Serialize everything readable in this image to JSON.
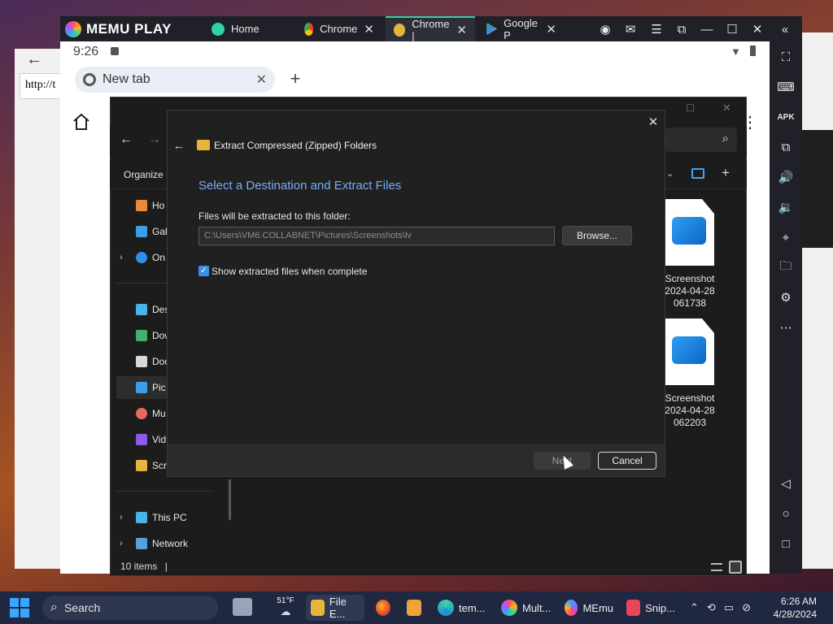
{
  "memu": {
    "logo_text": "MEMU PLAY",
    "tabs": [
      {
        "label": "Home"
      },
      {
        "label": "Chrome"
      },
      {
        "label": "Chrome |"
      },
      {
        "label": "Google P"
      }
    ]
  },
  "background_browser": {
    "address": "http://t"
  },
  "android": {
    "time": "9:26",
    "chrome_tab_title": "New tab"
  },
  "explorer": {
    "organize_label": "Organize",
    "sidebar": [
      {
        "label": "Ho"
      },
      {
        "label": "Gal"
      },
      {
        "label": "On"
      },
      {
        "label": "Des"
      },
      {
        "label": "Dow"
      },
      {
        "label": "Doc"
      },
      {
        "label": "Pic"
      },
      {
        "label": "Mu"
      },
      {
        "label": "Vid"
      },
      {
        "label": "Scr"
      },
      {
        "label": "This PC"
      },
      {
        "label": "Network"
      }
    ],
    "files": [
      {
        "name_line1": "Screenshot",
        "name_line2": "2024-04-28",
        "name_line3": "061738"
      },
      {
        "name_line1": "Screenshot",
        "name_line2": "2024-04-28",
        "name_line3": "062203"
      }
    ],
    "status": "10 items"
  },
  "dialog": {
    "title": "Extract Compressed (Zipped) Folders",
    "heading": "Select a Destination and Extract Files",
    "destination_label": "Files will be extracted to this folder:",
    "destination_value": "C:\\Users\\VM6.COLLABNET\\Pictures\\Screenshots\\lv",
    "browse_label": "Browse...",
    "checkbox_label": "Show extracted files when complete",
    "checkbox_checked": true,
    "next_label": "Next",
    "cancel_label": "Cancel"
  },
  "taskbar": {
    "search_label": "Search",
    "weather": "51°F",
    "apps": [
      {
        "label": "File E..."
      },
      {
        "label": "tem..."
      },
      {
        "label": "Mult..."
      },
      {
        "label": "MEmu"
      },
      {
        "label": "Snip..."
      }
    ],
    "time": "6:26 AM",
    "date": "4/28/2024"
  }
}
